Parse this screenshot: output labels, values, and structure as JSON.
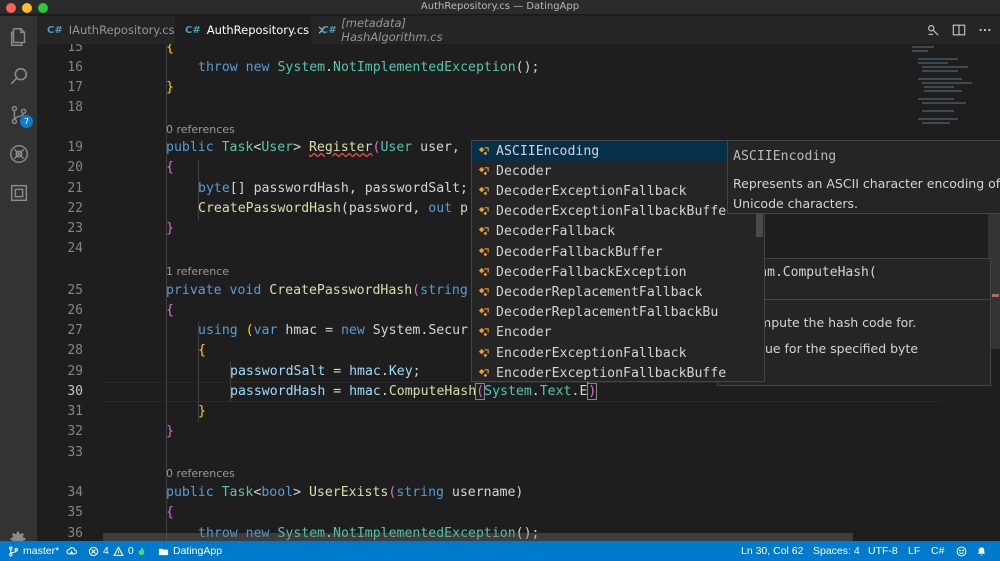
{
  "window": {
    "title": "AuthRepository.cs — DatingApp"
  },
  "activity": {
    "scm_badge": "7"
  },
  "tabs": [
    {
      "lang": "C#",
      "label": "IAuthRepository.cs"
    },
    {
      "lang": "C#",
      "label": "AuthRepository.cs",
      "close": "×"
    },
    {
      "lang": "C#",
      "label": "[metadata] HashAlgorithm.cs"
    }
  ],
  "editor": {
    "line_numbers": [
      "15",
      "16",
      "17",
      "18",
      "19",
      "20",
      "21",
      "22",
      "23",
      "24",
      "25",
      "26",
      "27",
      "28",
      "29",
      "30",
      "31",
      "32",
      "33",
      "34",
      "35",
      "36"
    ],
    "codelens": [
      "0 references",
      "1 reference",
      "0 references"
    ],
    "code": {
      "l15": "{",
      "l16_a": "throw",
      "l16_b": "new",
      "l16_c": "System",
      "l16_d": ".",
      "l16_e": "NotImplementedException",
      "l16_f": "();",
      "l17": "}",
      "l19_a": "public",
      "l19_b": "Task",
      "l19_c": "<",
      "l19_d": "User",
      "l19_e": "> ",
      "l19_f": "Register",
      "l19_g": "(",
      "l19_h": "User",
      "l19_i": " user,",
      "l20": "{",
      "l21_a": "byte",
      "l21_b": "[] passwordHash, passwordSalt;",
      "l22_a": "CreatePasswordHash",
      "l22_b": "(password, ",
      "l22_c": "out",
      "l22_d": " p",
      "l23": "}",
      "l25_a": "private",
      "l25_b": "void",
      "l25_c": "CreatePasswordHash",
      "l25_d": "(",
      "l25_e": "string",
      "l26": "{",
      "l27_a": "using",
      "l27_b": "(",
      "l27_c": "var",
      "l27_d": " hmac = ",
      "l27_e": "new",
      "l27_f": " System.Secur",
      "l28": "{",
      "l29_a": "passwordSalt",
      "l29_b": " = ",
      "l29_c": "hmac",
      "l29_d": ".",
      "l29_e": "Key",
      "l29_f": ";",
      "l30_a": "passwordHash",
      "l30_b": " = ",
      "l30_c": "hmac",
      "l30_d": ".",
      "l30_e": "ComputeHash",
      "l30_f": "(",
      "l30_g": "System",
      "l30_h": ".",
      "l30_i": "Text",
      "l30_j": ".",
      "l30_k": "E",
      "l30_l": ")",
      "l31": "}",
      "l32": "}",
      "l34_a": "public",
      "l34_b": "Task",
      "l34_c": "<",
      "l34_d": "bool",
      "l34_e": "> ",
      "l34_f": "UserExists",
      "l34_g": "(",
      "l34_h": "string",
      "l34_i": " username)",
      "l35": "{",
      "l36_a": "throw",
      "l36_b": "new",
      "l36_c": "System",
      "l36_d": ".",
      "l36_e": "NotImplementedException",
      "l36_f": "();"
    }
  },
  "hover": {
    "signature": "orithm.ComputeHash(",
    "param_desc": "to compute the hash code for.",
    "return_desc": "sh value for the specified byte"
  },
  "suggest": {
    "items": [
      "ASCIIEncoding",
      "Decoder",
      "DecoderExceptionFallback",
      "DecoderExceptionFallbackBuffe",
      "DecoderFallback",
      "DecoderFallbackBuffer",
      "DecoderFallbackException",
      "DecoderReplacementFallback",
      "DecoderReplacementFallbackBu",
      "Encoder",
      "EncoderExceptionFallback",
      "EncoderExceptionFallbackBuffe"
    ],
    "selected_index": 0
  },
  "details": {
    "title": "ASCIIEncoding",
    "close": "×",
    "description": "Represents an ASCII character encoding of Unicode characters."
  },
  "status": {
    "branch": "master*",
    "errors": "4",
    "warnings": "0",
    "project": "DatingApp",
    "position": "Ln 30, Col 62",
    "spaces": "Spaces: 4",
    "encoding": "UTF-8",
    "eol": "LF",
    "language": "C#"
  },
  "colors": {
    "statusbar": "#007acc",
    "accent": "#0e7ad1",
    "suggest_selected": "#062f4a"
  }
}
